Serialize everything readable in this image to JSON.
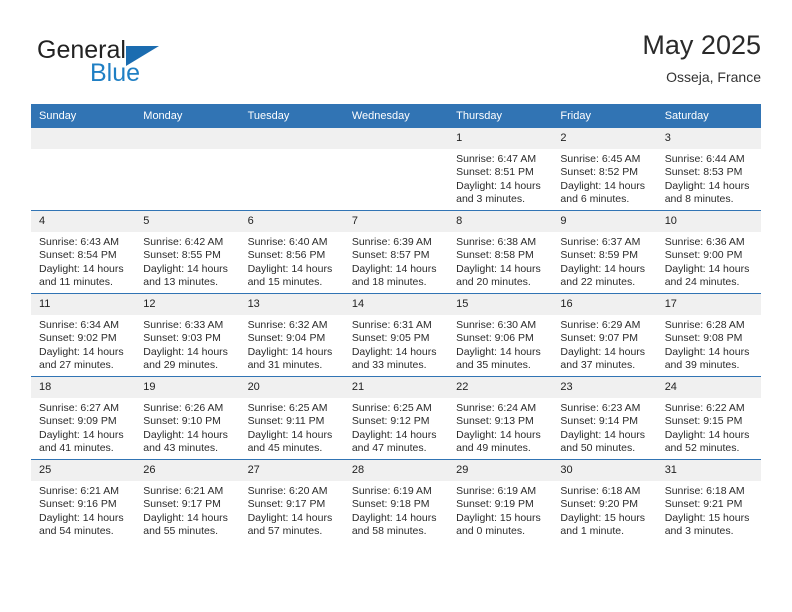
{
  "brand": {
    "name_part1": "General",
    "name_part2": "Blue",
    "logo_icon": "triangle-logo-icon"
  },
  "header": {
    "title": "May 2025",
    "subtitle": "Osseja, France"
  },
  "calendar": {
    "weekday_headers": [
      "Sunday",
      "Monday",
      "Tuesday",
      "Wednesday",
      "Thursday",
      "Friday",
      "Saturday"
    ],
    "accent_color": "#3174b4",
    "daynum_band_color": "#f0f0f0",
    "weeks": [
      [
        {
          "day": "",
          "empty": true
        },
        {
          "day": "",
          "empty": true
        },
        {
          "day": "",
          "empty": true
        },
        {
          "day": "",
          "empty": true
        },
        {
          "day": "1",
          "sunrise": "Sunrise: 6:47 AM",
          "sunset": "Sunset: 8:51 PM",
          "daylight": "Daylight: 14 hours and 3 minutes."
        },
        {
          "day": "2",
          "sunrise": "Sunrise: 6:45 AM",
          "sunset": "Sunset: 8:52 PM",
          "daylight": "Daylight: 14 hours and 6 minutes."
        },
        {
          "day": "3",
          "sunrise": "Sunrise: 6:44 AM",
          "sunset": "Sunset: 8:53 PM",
          "daylight": "Daylight: 14 hours and 8 minutes."
        }
      ],
      [
        {
          "day": "4",
          "sunrise": "Sunrise: 6:43 AM",
          "sunset": "Sunset: 8:54 PM",
          "daylight": "Daylight: 14 hours and 11 minutes."
        },
        {
          "day": "5",
          "sunrise": "Sunrise: 6:42 AM",
          "sunset": "Sunset: 8:55 PM",
          "daylight": "Daylight: 14 hours and 13 minutes."
        },
        {
          "day": "6",
          "sunrise": "Sunrise: 6:40 AM",
          "sunset": "Sunset: 8:56 PM",
          "daylight": "Daylight: 14 hours and 15 minutes."
        },
        {
          "day": "7",
          "sunrise": "Sunrise: 6:39 AM",
          "sunset": "Sunset: 8:57 PM",
          "daylight": "Daylight: 14 hours and 18 minutes."
        },
        {
          "day": "8",
          "sunrise": "Sunrise: 6:38 AM",
          "sunset": "Sunset: 8:58 PM",
          "daylight": "Daylight: 14 hours and 20 minutes."
        },
        {
          "day": "9",
          "sunrise": "Sunrise: 6:37 AM",
          "sunset": "Sunset: 8:59 PM",
          "daylight": "Daylight: 14 hours and 22 minutes."
        },
        {
          "day": "10",
          "sunrise": "Sunrise: 6:36 AM",
          "sunset": "Sunset: 9:00 PM",
          "daylight": "Daylight: 14 hours and 24 minutes."
        }
      ],
      [
        {
          "day": "11",
          "sunrise": "Sunrise: 6:34 AM",
          "sunset": "Sunset: 9:02 PM",
          "daylight": "Daylight: 14 hours and 27 minutes."
        },
        {
          "day": "12",
          "sunrise": "Sunrise: 6:33 AM",
          "sunset": "Sunset: 9:03 PM",
          "daylight": "Daylight: 14 hours and 29 minutes."
        },
        {
          "day": "13",
          "sunrise": "Sunrise: 6:32 AM",
          "sunset": "Sunset: 9:04 PM",
          "daylight": "Daylight: 14 hours and 31 minutes."
        },
        {
          "day": "14",
          "sunrise": "Sunrise: 6:31 AM",
          "sunset": "Sunset: 9:05 PM",
          "daylight": "Daylight: 14 hours and 33 minutes."
        },
        {
          "day": "15",
          "sunrise": "Sunrise: 6:30 AM",
          "sunset": "Sunset: 9:06 PM",
          "daylight": "Daylight: 14 hours and 35 minutes."
        },
        {
          "day": "16",
          "sunrise": "Sunrise: 6:29 AM",
          "sunset": "Sunset: 9:07 PM",
          "daylight": "Daylight: 14 hours and 37 minutes."
        },
        {
          "day": "17",
          "sunrise": "Sunrise: 6:28 AM",
          "sunset": "Sunset: 9:08 PM",
          "daylight": "Daylight: 14 hours and 39 minutes."
        }
      ],
      [
        {
          "day": "18",
          "sunrise": "Sunrise: 6:27 AM",
          "sunset": "Sunset: 9:09 PM",
          "daylight": "Daylight: 14 hours and 41 minutes."
        },
        {
          "day": "19",
          "sunrise": "Sunrise: 6:26 AM",
          "sunset": "Sunset: 9:10 PM",
          "daylight": "Daylight: 14 hours and 43 minutes."
        },
        {
          "day": "20",
          "sunrise": "Sunrise: 6:25 AM",
          "sunset": "Sunset: 9:11 PM",
          "daylight": "Daylight: 14 hours and 45 minutes."
        },
        {
          "day": "21",
          "sunrise": "Sunrise: 6:25 AM",
          "sunset": "Sunset: 9:12 PM",
          "daylight": "Daylight: 14 hours and 47 minutes."
        },
        {
          "day": "22",
          "sunrise": "Sunrise: 6:24 AM",
          "sunset": "Sunset: 9:13 PM",
          "daylight": "Daylight: 14 hours and 49 minutes."
        },
        {
          "day": "23",
          "sunrise": "Sunrise: 6:23 AM",
          "sunset": "Sunset: 9:14 PM",
          "daylight": "Daylight: 14 hours and 50 minutes."
        },
        {
          "day": "24",
          "sunrise": "Sunrise: 6:22 AM",
          "sunset": "Sunset: 9:15 PM",
          "daylight": "Daylight: 14 hours and 52 minutes."
        }
      ],
      [
        {
          "day": "25",
          "sunrise": "Sunrise: 6:21 AM",
          "sunset": "Sunset: 9:16 PM",
          "daylight": "Daylight: 14 hours and 54 minutes."
        },
        {
          "day": "26",
          "sunrise": "Sunrise: 6:21 AM",
          "sunset": "Sunset: 9:17 PM",
          "daylight": "Daylight: 14 hours and 55 minutes."
        },
        {
          "day": "27",
          "sunrise": "Sunrise: 6:20 AM",
          "sunset": "Sunset: 9:17 PM",
          "daylight": "Daylight: 14 hours and 57 minutes."
        },
        {
          "day": "28",
          "sunrise": "Sunrise: 6:19 AM",
          "sunset": "Sunset: 9:18 PM",
          "daylight": "Daylight: 14 hours and 58 minutes."
        },
        {
          "day": "29",
          "sunrise": "Sunrise: 6:19 AM",
          "sunset": "Sunset: 9:19 PM",
          "daylight": "Daylight: 15 hours and 0 minutes."
        },
        {
          "day": "30",
          "sunrise": "Sunrise: 6:18 AM",
          "sunset": "Sunset: 9:20 PM",
          "daylight": "Daylight: 15 hours and 1 minute."
        },
        {
          "day": "31",
          "sunrise": "Sunrise: 6:18 AM",
          "sunset": "Sunset: 9:21 PM",
          "daylight": "Daylight: 15 hours and 3 minutes."
        }
      ]
    ]
  }
}
